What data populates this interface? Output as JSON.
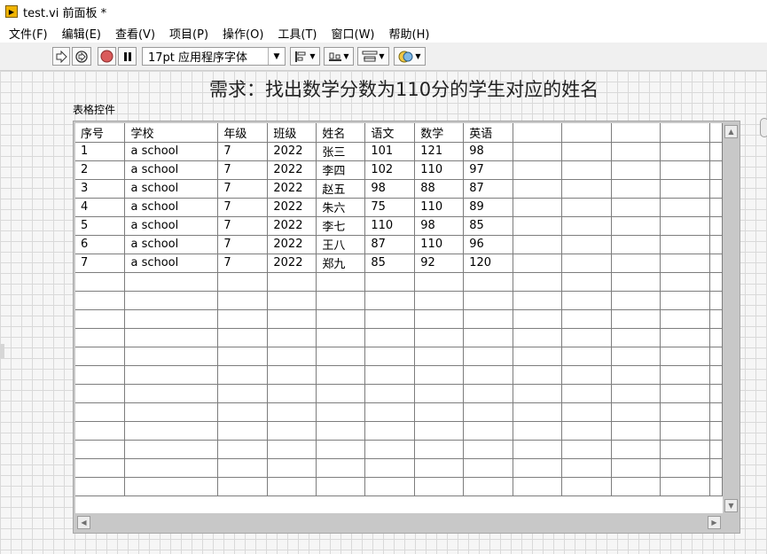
{
  "window": {
    "title": "test.vi 前面板 *",
    "icon": "labview-vi-icon"
  },
  "menu": [
    "文件(F)",
    "编辑(E)",
    "查看(V)",
    "项目(P)",
    "操作(O)",
    "工具(T)",
    "窗口(W)",
    "帮助(H)"
  ],
  "toolbar": {
    "font_selector": "17pt 应用程序字体",
    "icons": [
      "run-arrow-icon",
      "run-continuously-icon",
      "abort-icon",
      "pause-icon",
      "align-objects-icon",
      "distribute-objects-icon",
      "resize-objects-icon",
      "reorder-icon"
    ]
  },
  "panel": {
    "heading": "需求：找出数学分数为110分的学生对应的姓名",
    "control_label": "表格控件"
  },
  "table": {
    "headers": [
      "序号",
      "学校",
      "年级",
      "班级",
      "姓名",
      "语文",
      "数学",
      "英语",
      "",
      "",
      "",
      "",
      ""
    ],
    "rows": [
      [
        "1",
        "a school",
        "7",
        "2022",
        "张三",
        "101",
        "121",
        "98",
        "",
        "",
        "",
        "",
        ""
      ],
      [
        "2",
        "a school",
        "7",
        "2022",
        "李四",
        "102",
        "110",
        "97",
        "",
        "",
        "",
        "",
        ""
      ],
      [
        "3",
        "a school",
        "7",
        "2022",
        "赵五",
        "98",
        "88",
        "87",
        "",
        "",
        "",
        "",
        ""
      ],
      [
        "4",
        "a school",
        "7",
        "2022",
        "朱六",
        "75",
        "110",
        "89",
        "",
        "",
        "",
        "",
        ""
      ],
      [
        "5",
        "a school",
        "7",
        "2022",
        "李七",
        "110",
        "98",
        "85",
        "",
        "",
        "",
        "",
        ""
      ],
      [
        "6",
        "a school",
        "7",
        "2022",
        "王八",
        "87",
        "110",
        "96",
        "",
        "",
        "",
        "",
        ""
      ],
      [
        "7",
        "a school",
        "7",
        "2022",
        "郑九",
        "85",
        "92",
        "120",
        "",
        "",
        "",
        "",
        ""
      ]
    ],
    "empty_rows": 12
  },
  "colors": {
    "grid_line": "#d9d9d9",
    "panel_bg": "#f6f6f6",
    "table_frame": "#c8c8c8"
  }
}
